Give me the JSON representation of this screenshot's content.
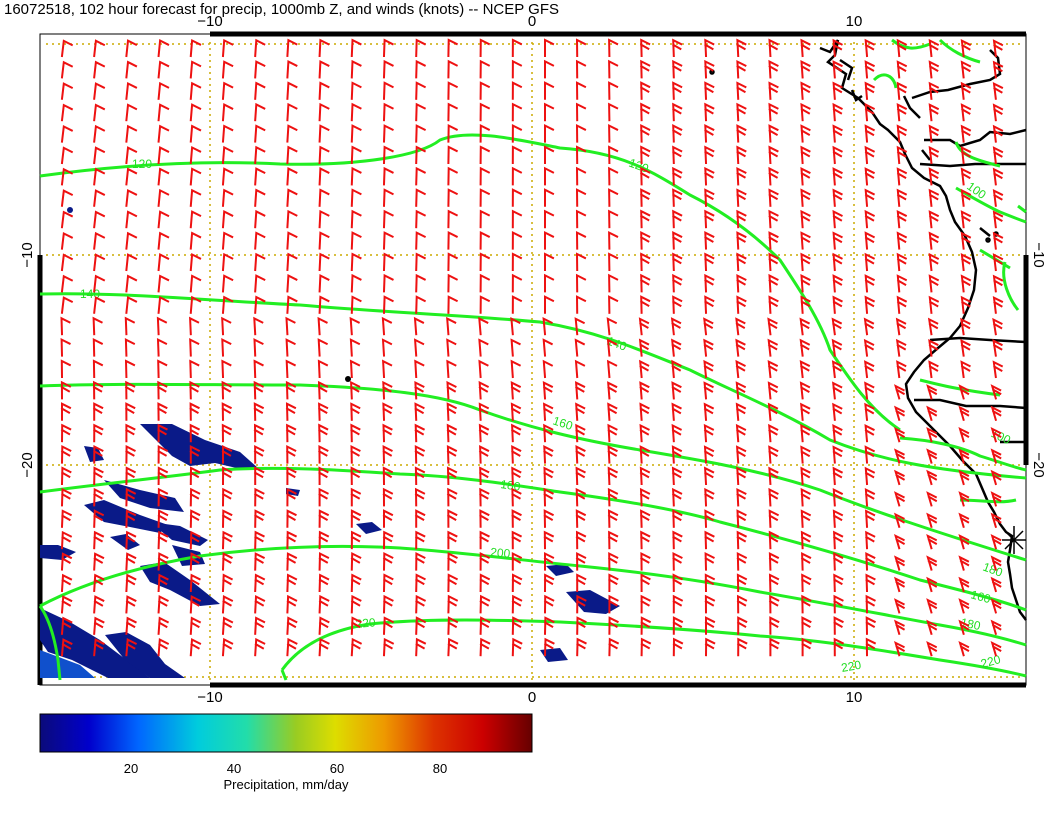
{
  "title": "16072518, 102 hour forecast for precip, 1000mb Z, and winds (knots) -- NCEP GFS",
  "axes": {
    "x_ticks": [
      "−10",
      "0",
      "10"
    ],
    "y_ticks": [
      "−10",
      "−20"
    ]
  },
  "contours": {
    "color": "#22ee22",
    "labels": [
      "120",
      "120",
      "100",
      "140",
      "140",
      "160",
      "180",
      "200",
      "220",
      "100",
      "160",
      "180",
      "180",
      "220",
      "220"
    ]
  },
  "winds": {
    "color": "#ee1111",
    "units": "knots"
  },
  "colorbar": {
    "label": "Precipitation, mm/day",
    "ticks": [
      "20",
      "40",
      "60",
      "80"
    ],
    "colors": [
      "#0b0b7a",
      "#0000cc",
      "#0066ff",
      "#00ccdd",
      "#22ddaa",
      "#99cc22",
      "#dddd00",
      "#ee9900",
      "#dd3300",
      "#cc0000",
      "#660000"
    ]
  },
  "precip_color": "#0a1a88",
  "coast_color": "#000000"
}
